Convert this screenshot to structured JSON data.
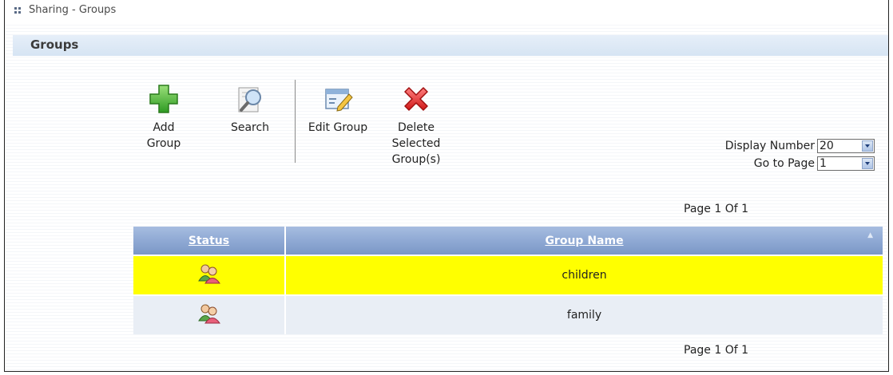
{
  "breadcrumb": "Sharing - Groups",
  "section_title": "Groups",
  "toolbar": {
    "add_label": "Add\nGroup",
    "search_label": "Search",
    "edit_label": "Edit Group",
    "delete_label": "Delete\nSelected\nGroup(s)"
  },
  "display_number": {
    "label": "Display Number",
    "value": "20"
  },
  "go_to_page": {
    "label": "Go to Page",
    "value": "1"
  },
  "page_info_top": "Page 1 Of 1",
  "page_info_bottom": "Page 1 Of 1",
  "table": {
    "columns": [
      "Status",
      "Group Name"
    ],
    "rows": [
      {
        "status_icon": "group-icon",
        "name": "children",
        "selected": true
      },
      {
        "status_icon": "group-icon",
        "name": "family",
        "selected": false
      }
    ]
  },
  "colors": {
    "selected_row": "#ffff00",
    "header_blue": "#8fa9d4",
    "section_header": "#dde8f5"
  }
}
